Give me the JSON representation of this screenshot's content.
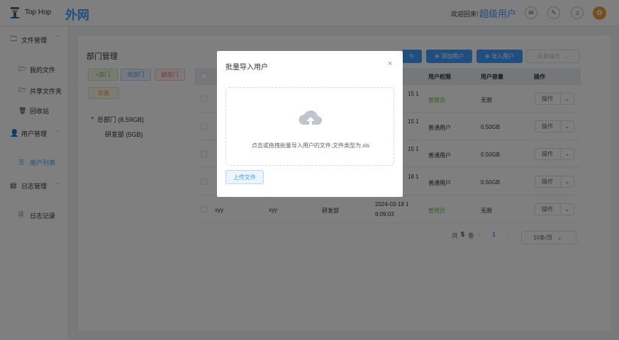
{
  "header": {
    "brand": "Top Hop",
    "net_title": "外网",
    "welcome": "欢迎回来!",
    "username": "超级用户",
    "icons": [
      "mail-icon",
      "edit-icon",
      "bell-icon"
    ]
  },
  "sidebar": {
    "file_mgmt": "文件管理",
    "my_files": "我的文件",
    "shared_folder": "共享文件夹",
    "recycle_bin": "回收站",
    "user_mgmt": "用户管理",
    "user_list": "用户列表",
    "log_mgmt": "日志管理",
    "log_records": "日志记录"
  },
  "dept": {
    "title": "部门管理",
    "add": "+部门",
    "edit": "改部门",
    "delete": "删部门",
    "capacity": "容量",
    "root": "总部门 (8.59GB)",
    "child": "研发部 (5GB)"
  },
  "toolbar": {
    "add_user": "添加用户",
    "import_user": "导入用户",
    "batch": "批量操作"
  },
  "table": {
    "headers": {
      "permission": "用户权限",
      "capacity": "用户容量",
      "action": "操作"
    },
    "rows": [
      {
        "time1": "15 1",
        "permission": "管理员",
        "capacity": "无限",
        "action": "操作"
      },
      {
        "time1": "15 1",
        "permission": "普通用户",
        "capacity": "0.50GB",
        "action": "操作"
      },
      {
        "time1": "15 1",
        "permission": "普通用户",
        "capacity": "0.50GB",
        "action": "操作"
      },
      {
        "time1": "18 1",
        "permission": "普通用户",
        "capacity": "0.50GB",
        "action": "操作"
      },
      {
        "account": "xyy",
        "name": "xyy",
        "dept": "研发部",
        "time1": "2024-03-18 1",
        "time2": "6:09:03",
        "permission": "管理员",
        "capacity": "无限",
        "action": "操作"
      }
    ]
  },
  "pager": {
    "total_prefix": "共",
    "total": "5",
    "total_suffix": "条",
    "page": "1",
    "page_size": "10条/页"
  },
  "dialog": {
    "title": "批量导入用户",
    "hint": "点击或拖拽批量导入用户的文件,文件类型为.xls",
    "upload": "上传文件"
  }
}
